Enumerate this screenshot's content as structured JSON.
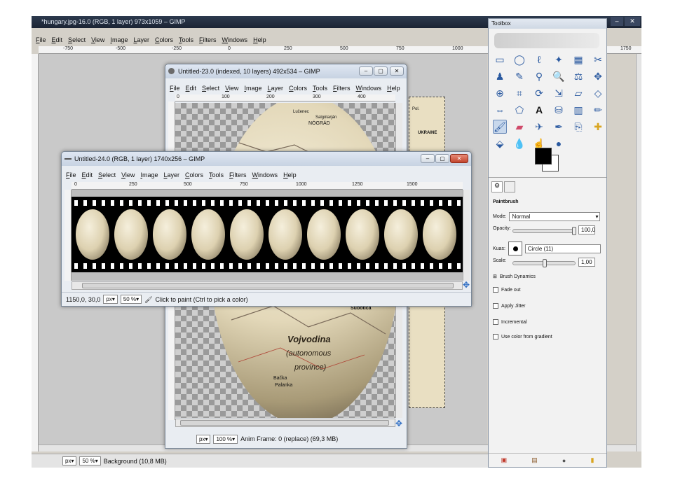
{
  "main_window": {
    "title": "*hungary.jpg-16.0 (RGB, 1 layer) 973x1059 – GIMP",
    "menu": [
      "File",
      "Edit",
      "Select",
      "View",
      "Image",
      "Layer",
      "Colors",
      "Tools",
      "Filters",
      "Windows",
      "Help"
    ],
    "ruler_ticks": [
      "-750",
      "-500",
      "-250",
      "0",
      "250",
      "500",
      "750",
      "1000",
      "1750"
    ],
    "status_unit": "px",
    "status_zoom": "50 %",
    "status_text": "Background (10,8 MB)"
  },
  "window23": {
    "title": "Untitled-23.0 (indexed, 10 layers) 492x534 – GIMP",
    "menu": [
      "File",
      "Edit",
      "Select",
      "View",
      "Image",
      "Layer",
      "Colors",
      "Tools",
      "Filters",
      "Windows",
      "Help"
    ],
    "ruler_ticks": [
      "0",
      "100",
      "200",
      "300",
      "400"
    ],
    "status_unit": "px",
    "status_zoom": "100 %",
    "status_text": "Anim Frame: 0 (replace) (69,3 MB)",
    "map_labels": [
      "Lučenec",
      "NÓGRÁD",
      "Salgótarján",
      "Subotica",
      "Vojvodina",
      "(autonomous",
      "province)",
      "Bačka",
      "Palanka",
      "UKRAINE",
      "Pol."
    ]
  },
  "window24": {
    "title": "Untitled-24.0 (RGB, 1 layer) 1740x256 – GIMP",
    "menu": [
      "File",
      "Edit",
      "Select",
      "View",
      "Image",
      "Layer",
      "Colors",
      "Tools",
      "Filters",
      "Windows",
      "Help"
    ],
    "ruler_ticks": [
      "0",
      "250",
      "500",
      "750",
      "1000",
      "1250",
      "1500"
    ],
    "coords": "1150,0, 30,0",
    "status_unit": "px",
    "status_zoom": "50 %",
    "status_text": "Click to paint (Ctrl to pick a color)",
    "frame_count": 10
  },
  "toolbox": {
    "title": "Toolbox",
    "tool_name": "Paintbrush",
    "mode_label": "Mode:",
    "mode_value": "Normal",
    "opacity_label": "Opacity:",
    "opacity_value": "100,0",
    "opacity_level": 1.0,
    "brush_label": "Kuas:",
    "brush_value": "Circle (11)",
    "scale_label": "Scale:",
    "scale_value": "1,00",
    "scale_level": 0.5,
    "brush_dynamics": "Brush Dynamics",
    "options": [
      "Fade out",
      "Apply Jitter",
      "Incremental",
      "Use color from gradient"
    ],
    "fg_color": "#000000",
    "bg_color": "#ffffff"
  }
}
